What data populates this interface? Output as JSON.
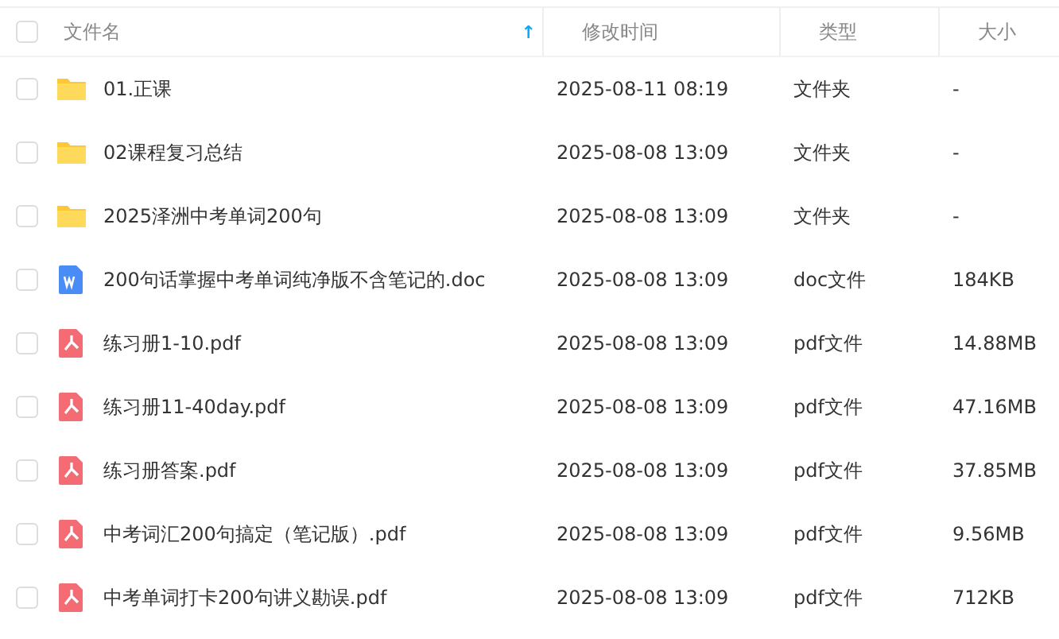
{
  "columns": [
    {
      "label": "文件名",
      "sort_arrow": "↑"
    },
    {
      "label": "修改时间"
    },
    {
      "label": "类型"
    },
    {
      "label": "大小"
    }
  ],
  "header_checkbox": {
    "checked": false
  },
  "rows": [
    {
      "kind": "folder",
      "name": "01.正课",
      "modified": "2025-08-11 08:19",
      "type": "文件夹",
      "size": "-",
      "checked": false
    },
    {
      "kind": "folder",
      "name": "02课程复习总结",
      "modified": "2025-08-08 13:09",
      "type": "文件夹",
      "size": "-",
      "checked": false
    },
    {
      "kind": "folder",
      "name": "2025泽洲中考单词200句",
      "modified": "2025-08-08 13:09",
      "type": "文件夹",
      "size": "-",
      "checked": false
    },
    {
      "kind": "doc",
      "name": "200句话掌握中考单词纯净版不含笔记的.doc",
      "modified": "2025-08-08 13:09",
      "type": "doc文件",
      "size": "184KB",
      "checked": false
    },
    {
      "kind": "pdf",
      "name": "练习册1-10.pdf",
      "modified": "2025-08-08 13:09",
      "type": "pdf文件",
      "size": "14.88MB",
      "checked": false
    },
    {
      "kind": "pdf",
      "name": "练习册11-40day.pdf",
      "modified": "2025-08-08 13:09",
      "type": "pdf文件",
      "size": "47.16MB",
      "checked": false
    },
    {
      "kind": "pdf",
      "name": "练习册答案.pdf",
      "modified": "2025-08-08 13:09",
      "type": "pdf文件",
      "size": "37.85MB",
      "checked": false
    },
    {
      "kind": "pdf",
      "name": "中考词汇200句搞定（笔记版）.pdf",
      "modified": "2025-08-08 13:09",
      "type": "pdf文件",
      "size": "9.56MB",
      "checked": false
    },
    {
      "kind": "pdf",
      "name": "中考单词打卡200句讲义勘误.pdf",
      "modified": "2025-08-08 13:09",
      "type": "pdf文件",
      "size": "712KB",
      "checked": false
    }
  ]
}
